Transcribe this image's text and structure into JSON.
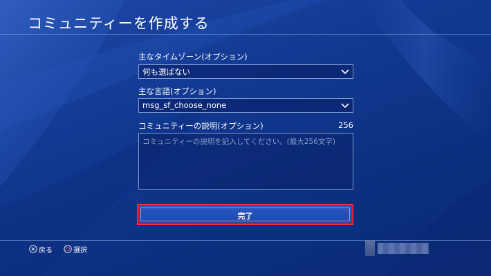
{
  "page": {
    "title": "コミュニティーを作成する"
  },
  "form": {
    "timezone": {
      "label": "主なタイムゾーン(オプション)",
      "value": "何も選ばない"
    },
    "language": {
      "label": "主な言語(オプション)",
      "value": "msg_sf_choose_none"
    },
    "description": {
      "label": "コミュニティーの説明(オプション)",
      "remaining": "256",
      "placeholder": "コミュニティーの説明を記入してください。(最大256文字)"
    }
  },
  "done_button": {
    "label": "完了"
  },
  "footer": {
    "back_label": "戻る",
    "select_label": "選択"
  },
  "icons": {
    "dropdown": "chevron-down-icon",
    "back": "cross-button-icon",
    "select": "circle-button-icon"
  },
  "colors": {
    "background": "#123a92",
    "focus_border": "#e0102a",
    "button_fill": "#2a58c2"
  }
}
